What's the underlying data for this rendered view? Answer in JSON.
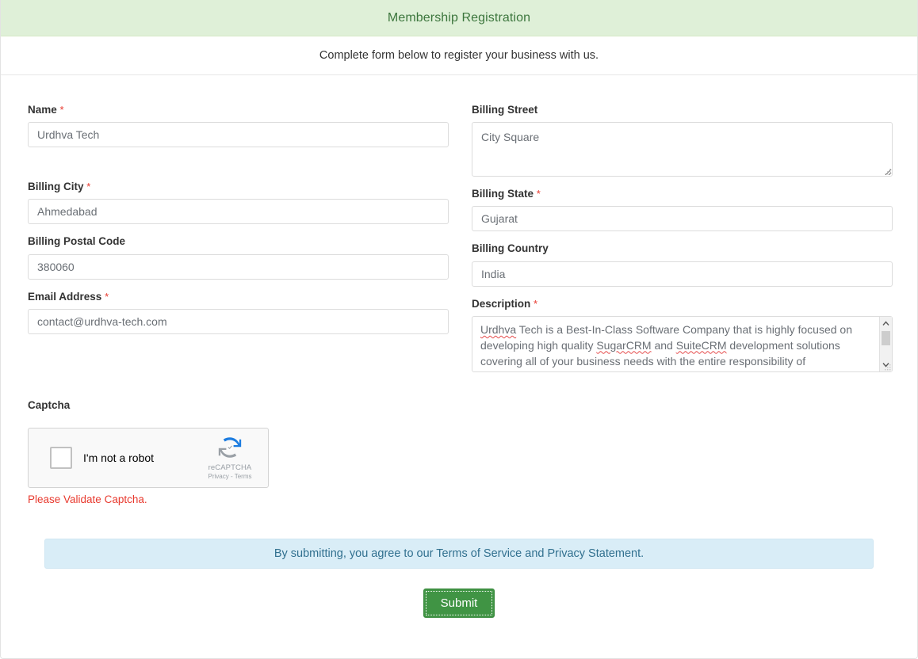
{
  "header": {
    "title": "Membership Registration",
    "subtitle": "Complete form below to register your business with us.",
    "title_bg": "#dff0d8",
    "title_color": "#3c763d"
  },
  "form": {
    "left": {
      "name": {
        "label": "Name",
        "required": "*",
        "value": "Urdhva Tech"
      },
      "billing_city": {
        "label": "Billing City",
        "required": "*",
        "value": "Ahmedabad"
      },
      "billing_postal_code": {
        "label": "Billing Postal Code",
        "required": "",
        "value": "380060"
      },
      "email_address": {
        "label": "Email Address",
        "required": "*",
        "value": "contact@urdhva-tech.com"
      }
    },
    "right": {
      "billing_street": {
        "label": "Billing Street",
        "required": "",
        "value": "City Square"
      },
      "billing_state": {
        "label": "Billing State",
        "required": "*",
        "value": "Gujarat"
      },
      "billing_country": {
        "label": "Billing Country",
        "required": "",
        "value": "India"
      },
      "description": {
        "label": "Description",
        "required": "*",
        "value": "Urdhva Tech is a Best-In-Class Software Company that is highly focused on developing high quality SugarCRM and SuiteCRM development solutions covering all of your business needs with the entire responsibility of",
        "line1_a": "Urdhva",
        "line1_b": " Tech is a Best-In-Class Software Company that is highly focused on",
        "line2_a": "developing high quality ",
        "line2_b": "SugarCRM",
        "line2_c": " and ",
        "line2_d": "SuiteCRM",
        "line2_e": " development solutions",
        "line3": "covering all of your business needs with the entire responsibility of"
      }
    }
  },
  "captcha": {
    "label": "Captcha",
    "checkbox_label": "I'm not a robot",
    "brand_name": "reCAPTCHA",
    "terms": "Privacy - Terms",
    "error": "Please Validate Captcha.",
    "error_color": "#e8392e"
  },
  "terms_banner": {
    "text": "By submitting, you agree to our Terms of Service and Privacy Statement.",
    "bg": "#d9edf7",
    "color": "#31708f"
  },
  "submit": {
    "label": "Submit",
    "bg": "#409444",
    "color": "#ffffff"
  }
}
